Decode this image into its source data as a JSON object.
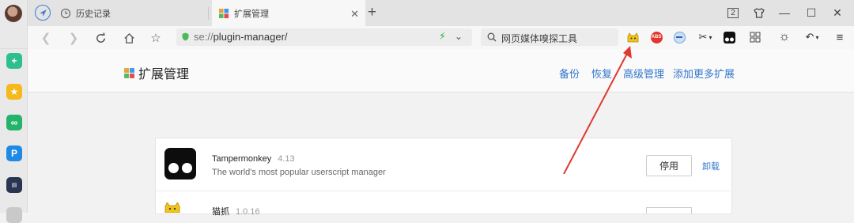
{
  "tabs": [
    {
      "title": "历史记录",
      "icon": "clock-icon"
    },
    {
      "title": "扩展管理",
      "icon": "extensions-icon"
    }
  ],
  "window_controls": {
    "badge": "2"
  },
  "address_bar": {
    "scheme": "se://",
    "path": "plugin-manager/"
  },
  "search_bar": {
    "placeholder": "网页媒体嗅探工具"
  },
  "extension_icons": [
    "cat-extension-icon",
    "adblock-icon",
    "minus-circle-icon",
    "scissors-icon",
    "tampermonkey-icon",
    "grid-icon",
    "brightness-icon",
    "undo-icon",
    "menu-icon"
  ],
  "adblock_label": "ABS",
  "page": {
    "title": "扩展管理",
    "links": [
      "备份",
      "恢复",
      "高级管理",
      "添加更多扩展"
    ]
  },
  "extensions": [
    {
      "name": "Tampermonkey",
      "version": "4.13",
      "description": "The world's most popular userscript manager",
      "disable_label": "停用",
      "uninstall_label": "卸载"
    },
    {
      "name": "猫抓",
      "version": "1.0.16"
    }
  ],
  "colors": {
    "accent": "#3377cc",
    "annotation_arrow": "#e03a2f"
  }
}
